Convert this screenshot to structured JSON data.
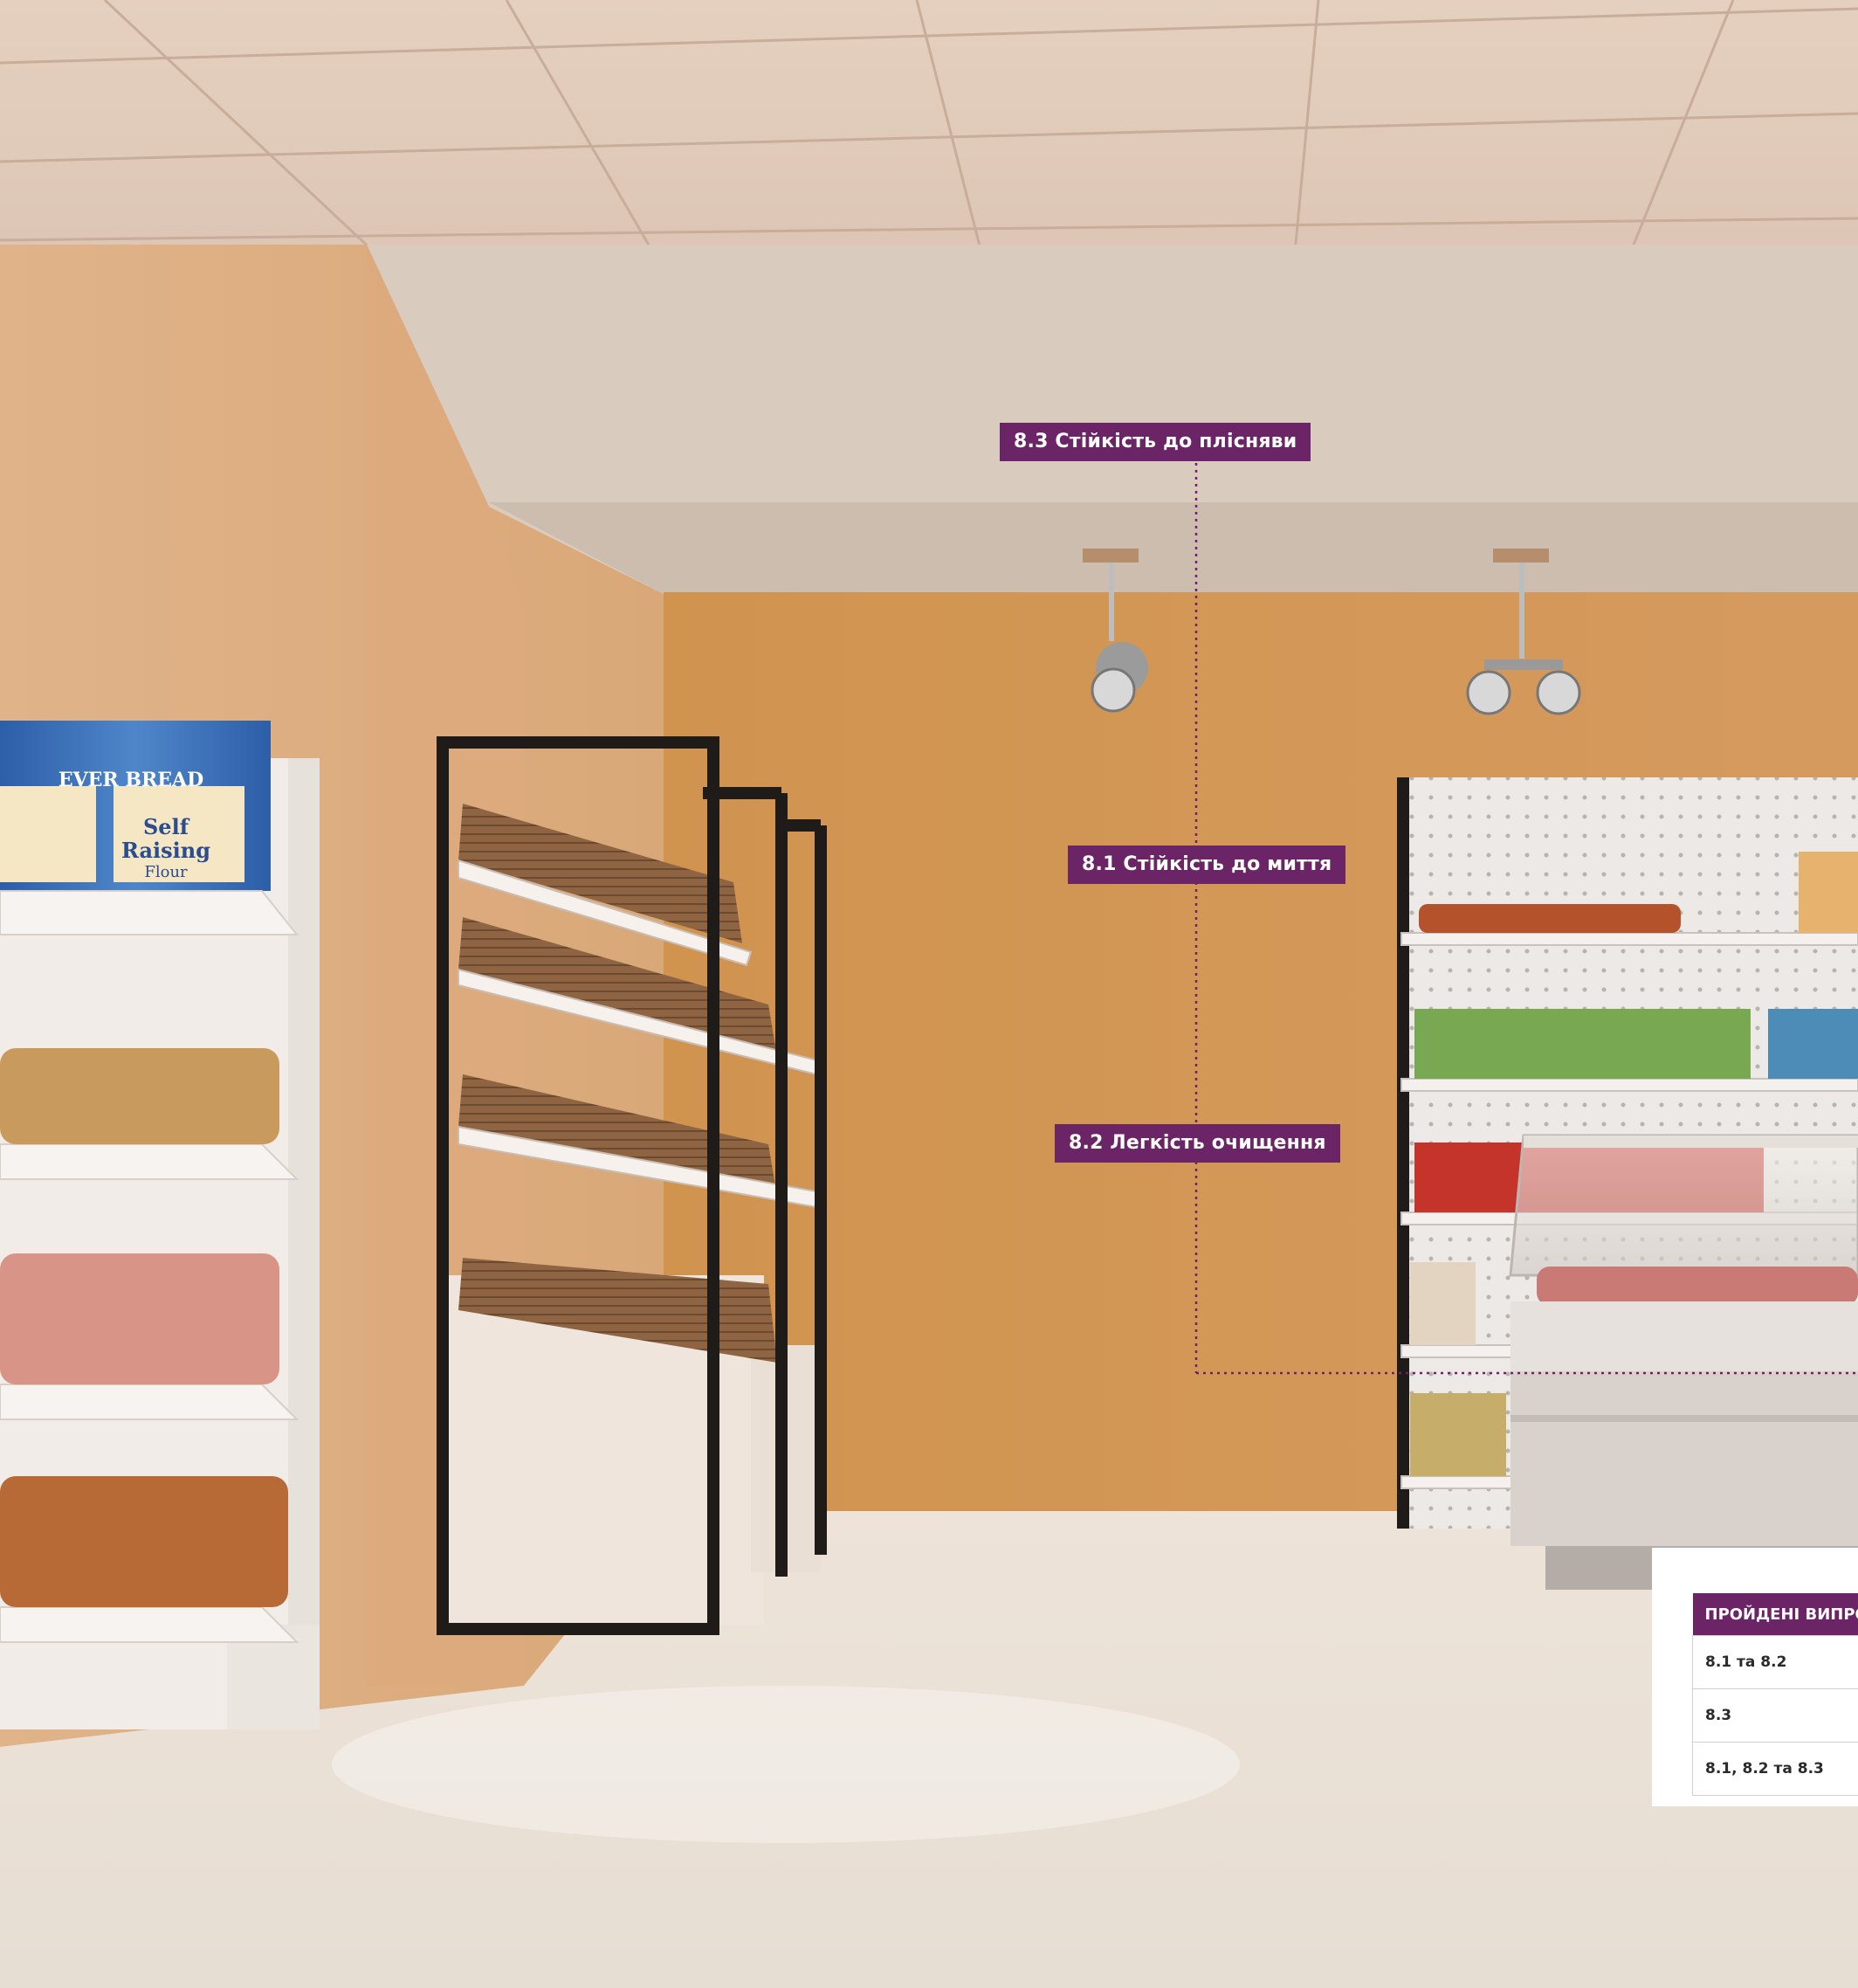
{
  "labels": {
    "washing": "8.1 Стійкість до миття",
    "cleaning": "8.2 Легкість очищення",
    "mold": "8.3 Стійкість до плісняви"
  },
  "legend": {
    "header": "ПРОЙДЕНІ ВИПРО",
    "rows": [
      "8.1 та 8.2",
      "8.3",
      "8.1, 8.2 та 8.3"
    ]
  },
  "products": {
    "flour_brand": "EVER BREAD",
    "flour_line1": "Self",
    "flour_line2": "Raising",
    "flour_line3": "Flour"
  },
  "colors": {
    "label_bg": "#6b2466",
    "wall": "#d79a5e",
    "ceiling": "#ddc7b6",
    "floor": "#eae2d9"
  }
}
